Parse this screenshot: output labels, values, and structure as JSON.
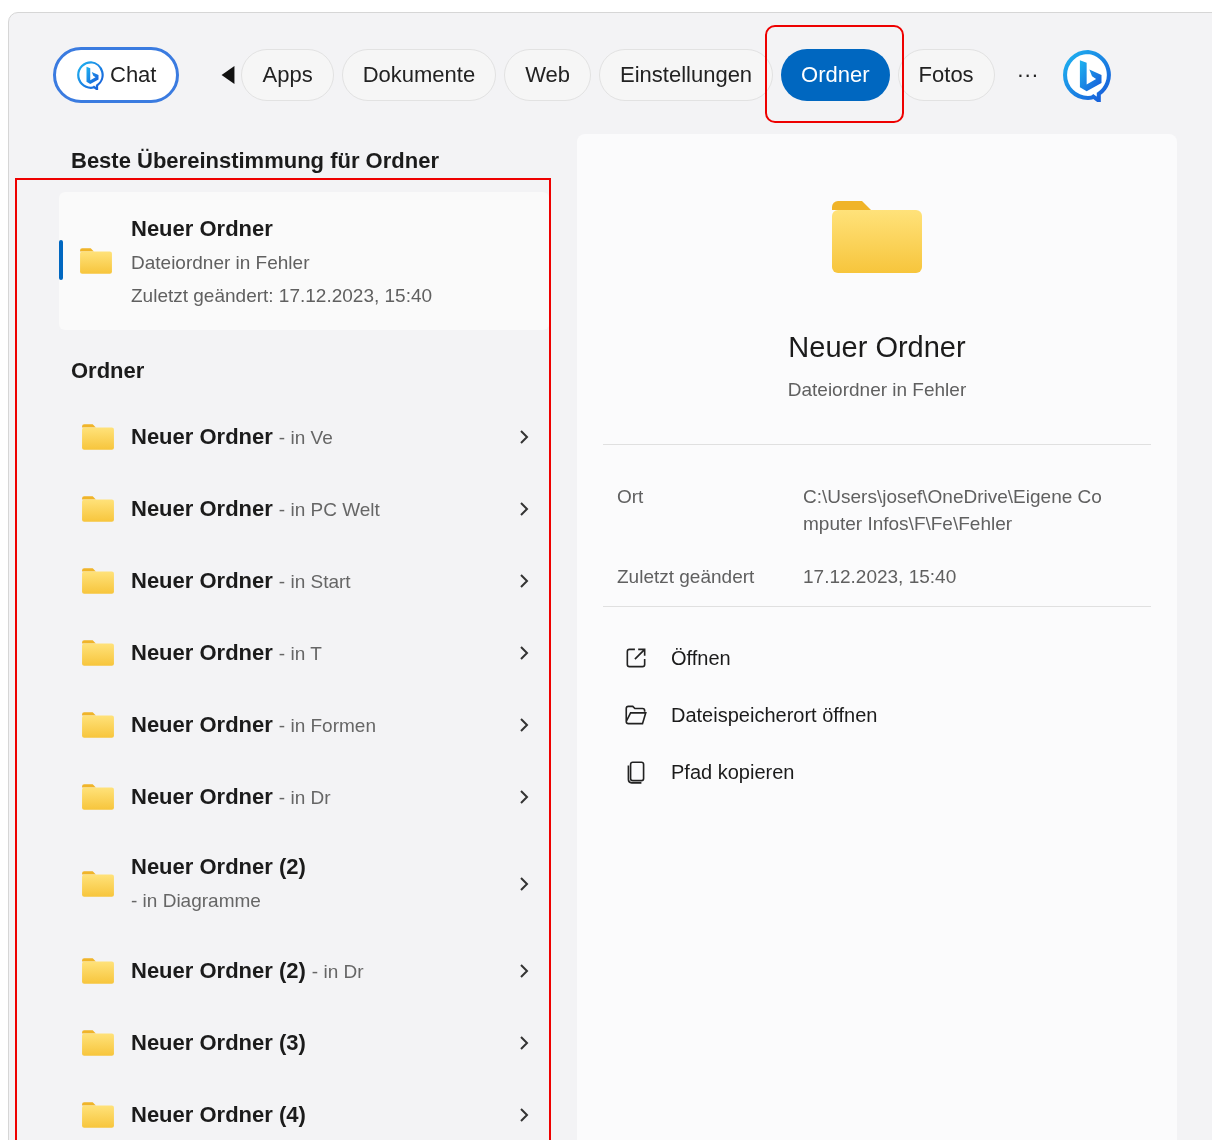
{
  "filters": [
    {
      "label": "Chat",
      "kind": "chat",
      "selected": false,
      "highlighted": false
    },
    {
      "label": "Apps",
      "kind": "chip",
      "selected": false,
      "highlighted": false
    },
    {
      "label": "Dokumente",
      "kind": "chip",
      "selected": false,
      "highlighted": false
    },
    {
      "label": "Web",
      "kind": "chip",
      "selected": false,
      "highlighted": false
    },
    {
      "label": "Einstellungen",
      "kind": "chip",
      "selected": false,
      "highlighted": false
    },
    {
      "label": "Ordner",
      "kind": "chip",
      "selected": true,
      "highlighted": true
    },
    {
      "label": "Fotos",
      "kind": "chip",
      "selected": false,
      "highlighted": false
    }
  ],
  "more_label": "···",
  "results": {
    "highlighted": true,
    "best_match_heading": "Beste Übereinstimmung für Ordner",
    "best_match": {
      "name": "Neuer Ordner",
      "type": "Dateiordner in Fehler",
      "modified": "Zuletzt geändert: 17.12.2023, 15:40",
      "selected": true
    },
    "section_heading": "Ordner",
    "items": [
      {
        "name": "Neuer Ordner",
        "location": "- in Ve"
      },
      {
        "name": "Neuer Ordner",
        "location": "- in PC Welt"
      },
      {
        "name": "Neuer Ordner",
        "location": "- in Start"
      },
      {
        "name": "Neuer Ordner",
        "location": "- in T"
      },
      {
        "name": "Neuer Ordner",
        "location": "- in Formen"
      },
      {
        "name": "Neuer Ordner",
        "location": "- in Dr"
      },
      {
        "name": "Neuer Ordner (2)",
        "location": "- in Diagramme"
      },
      {
        "name": "Neuer Ordner (2)",
        "location": "- in Dr"
      },
      {
        "name": "Neuer Ordner (3)"
      },
      {
        "name": "Neuer Ordner (4)"
      }
    ]
  },
  "preview": {
    "name": "Neuer Ordner",
    "type": "Dateiordner in Fehler",
    "details": [
      {
        "label": "Ort",
        "value": "C:\\Users\\josef\\OneDrive\\Eigene Computer Infos\\F\\Fe\\Fehler"
      },
      {
        "label": "Zuletzt geändert",
        "value": "17.12.2023, 15:40"
      }
    ],
    "actions": [
      {
        "label": "Öffnen",
        "kind": "open"
      },
      {
        "label": "Dateispeicherort öffnen",
        "kind": "location"
      },
      {
        "label": "Pfad kopieren",
        "kind": "copy"
      }
    ]
  }
}
